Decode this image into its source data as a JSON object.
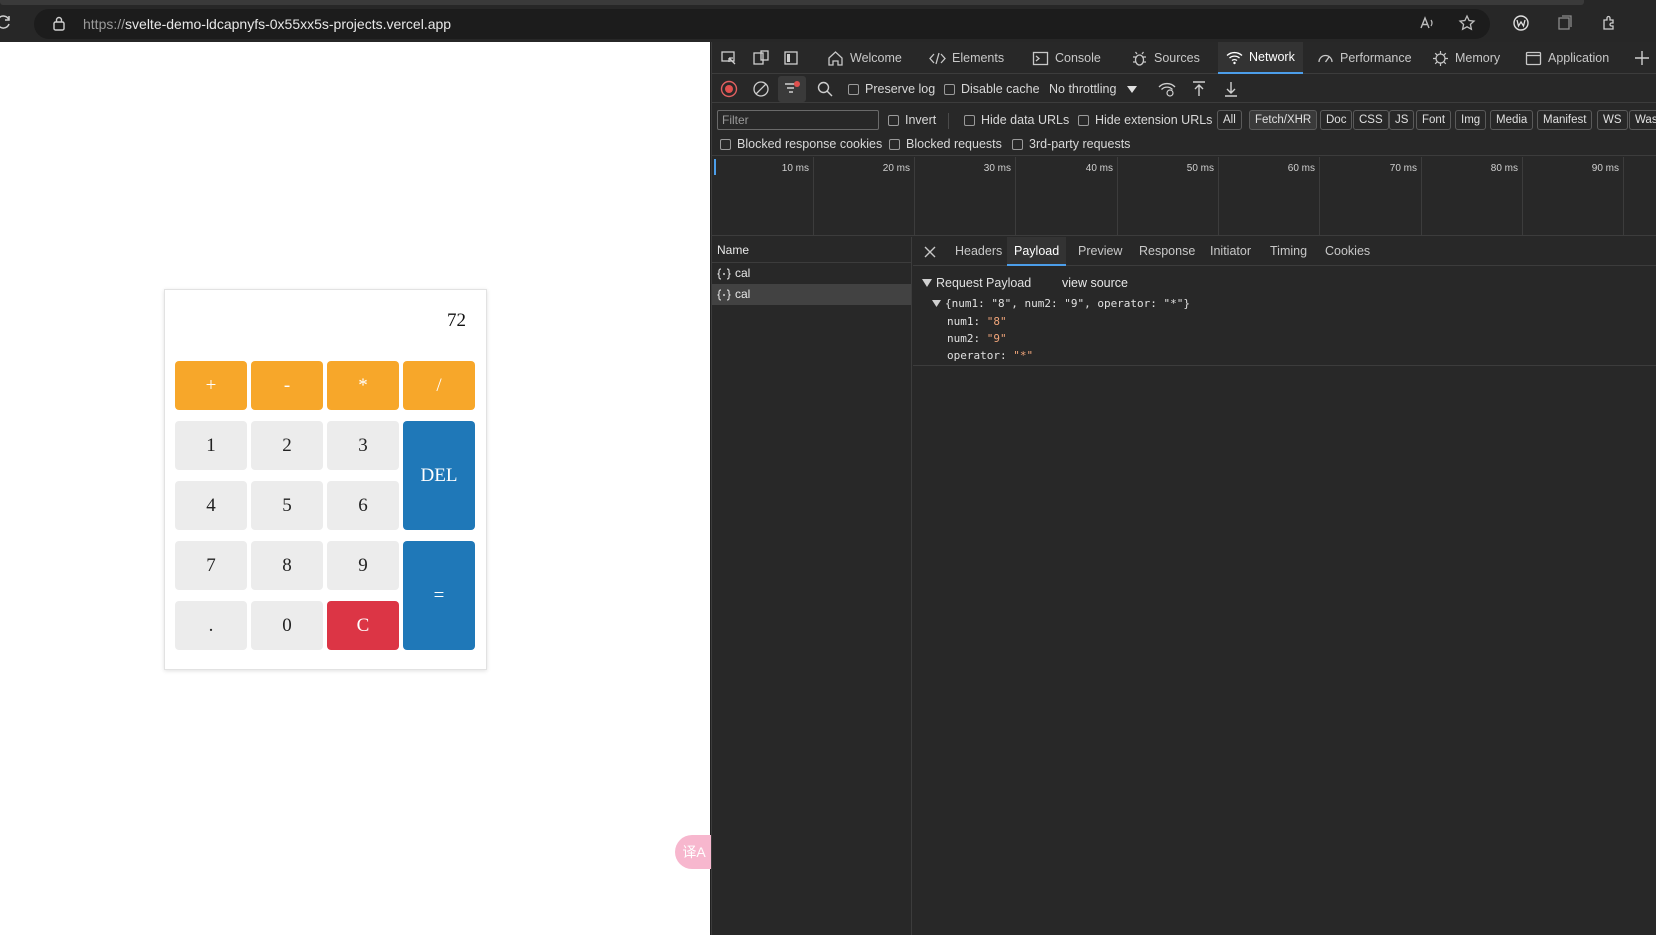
{
  "browser": {
    "url_prefix": "https://",
    "url_host": "svelte-demo-ldcapnyfs-0x55xx5s-projects.vercel.app"
  },
  "calculator": {
    "display": "72",
    "operators": [
      "+",
      "-",
      "*",
      "/"
    ],
    "digits": [
      "1",
      "2",
      "3",
      "4",
      "5",
      "6",
      "7",
      "8",
      "9",
      ".",
      "0"
    ],
    "del_label": "DEL",
    "equals_label": "=",
    "clear_label": "C",
    "colors": {
      "operator": "#f7a72a",
      "blue": "#1f78b8",
      "clear": "#dc3545",
      "digit": "#ececec"
    }
  },
  "translate_fab": {
    "icon": "translate-icon",
    "glyph": "译A"
  },
  "devtools": {
    "tabs": [
      "Welcome",
      "Elements",
      "Console",
      "Sources",
      "Network",
      "Performance",
      "Memory",
      "Application"
    ],
    "active_tab": "Network",
    "toolbar": {
      "preserve_log": "Preserve log",
      "disable_cache": "Disable cache",
      "throttling": "No throttling"
    },
    "filter": {
      "placeholder": "Filter",
      "invert": "Invert",
      "hide_data_urls": "Hide data URLs",
      "hide_extension_urls": "Hide extension URLs",
      "types": [
        "All",
        "Fetch/XHR",
        "Doc",
        "CSS",
        "JS",
        "Font",
        "Img",
        "Media",
        "Manifest",
        "WS",
        "Was"
      ],
      "active_type": "Fetch/XHR",
      "blocked_response_cookies": "Blocked response cookies",
      "blocked_requests": "Blocked requests",
      "third_party_requests": "3rd-party requests"
    },
    "timeline_ticks": [
      "10 ms",
      "20 ms",
      "30 ms",
      "40 ms",
      "50 ms",
      "60 ms",
      "70 ms",
      "80 ms",
      "90 ms"
    ],
    "requests": {
      "header": "Name",
      "rows": [
        "cal",
        "cal"
      ],
      "selected_index": 1
    },
    "detail": {
      "tabs": [
        "Headers",
        "Payload",
        "Preview",
        "Response",
        "Initiator",
        "Timing",
        "Cookies"
      ],
      "active_tab": "Payload",
      "section_title": "Request Payload",
      "view_source": "view source",
      "summary": "{num1: \"8\", num2: \"9\", operator: \"*\"}",
      "fields": [
        {
          "key": "num1",
          "value": "\"8\""
        },
        {
          "key": "num2",
          "value": "\"9\""
        },
        {
          "key": "operator",
          "value": "\"*\""
        }
      ]
    }
  }
}
